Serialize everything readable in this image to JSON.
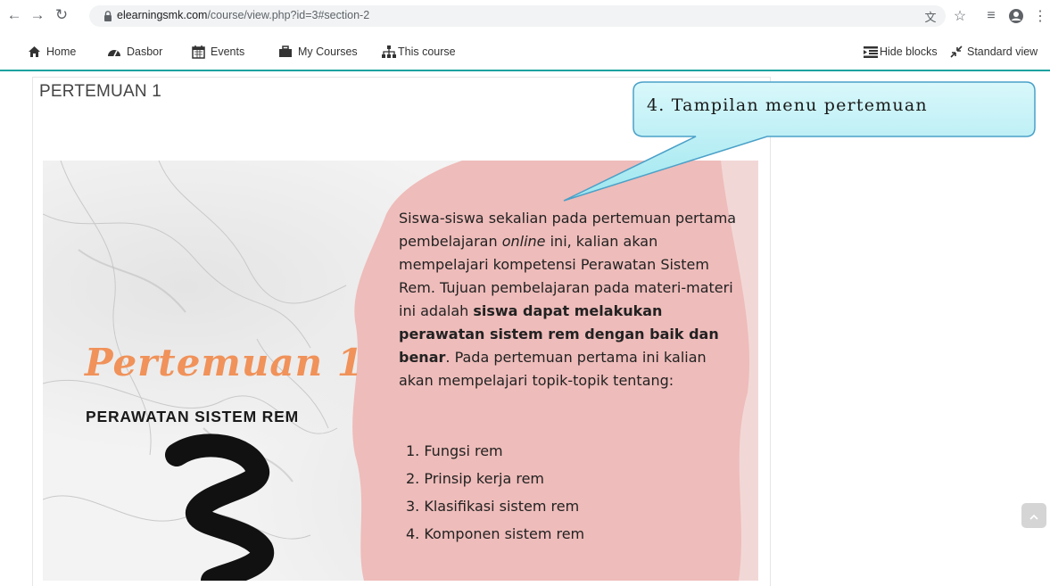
{
  "browser": {
    "url_domain": "elearningsmk.com",
    "url_path": "/course/view.php?id=3#section-2"
  },
  "nav": {
    "home": "Home",
    "dasbor": "Dasbor",
    "events": "Events",
    "my_courses": "My Courses",
    "this_course": "This course",
    "hide_blocks": "Hide blocks",
    "standard_view": "Standard view"
  },
  "section": {
    "title": "PERTEMUAN 1"
  },
  "banner": {
    "title": "Pertemuan 1",
    "subtitle": "PERAWATAN SISTEM REM",
    "intro_1": "Siswa-siswa sekalian pada pertemuan pertama pembelajaran ",
    "intro_online": "online",
    "intro_2": " ini, kalian akan mempelajari kompetensi Perawatan Sistem Rem. Tujuan pembelajaran pada materi-materi ini adalah ",
    "intro_bold": "siswa dapat melakukan perawatan sistem rem dengan baik dan benar",
    "intro_3": ". Pada pertemuan pertama ini kalian akan mempelajari topik-topik tentang:",
    "topics": [
      "1. Fungsi rem",
      "2. Prinsip kerja rem",
      "3. Klasifikasi sistem rem",
      "4. Komponen sistem rem"
    ]
  },
  "callout": {
    "text": "4. Tampilan menu pertemuan"
  },
  "colors": {
    "accent": "#17a2a0",
    "banner_title": "#f0925a",
    "pink_stroke": "#eebcba",
    "callout_fill": "#bdeff5"
  }
}
